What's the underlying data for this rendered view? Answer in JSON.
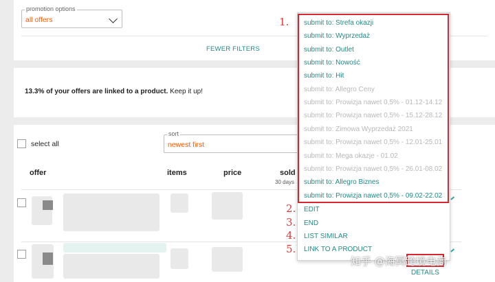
{
  "filters": {
    "promotion": {
      "legend": "promotion options",
      "value": "all offers"
    },
    "fewer_filters": "FEWER FILTERS"
  },
  "info": {
    "highlight": "13.3% of your offers are linked to a product.",
    "rest": " Keep it up!"
  },
  "list": {
    "select_all": "select all",
    "sort": {
      "legend": "sort",
      "value": "newest first"
    },
    "columns": {
      "offer": "offer",
      "items": "items",
      "price": "price",
      "sold": "sold",
      "sold_sub": "30 days"
    },
    "details": "DETAILS"
  },
  "dropdown": {
    "submit_items": [
      {
        "label": "submit to: Strefa okazji",
        "enabled": true
      },
      {
        "label": "submit to: Wyprzedaż",
        "enabled": true
      },
      {
        "label": "submit to: Outlet",
        "enabled": true
      },
      {
        "label": "submit to: Nowość",
        "enabled": true
      },
      {
        "label": "submit to: Hit",
        "enabled": true
      },
      {
        "label": "submit to: Allegro Ceny",
        "enabled": false
      },
      {
        "label": "submit to: Prowizja nawet 0,5% - 01.12-14.12",
        "enabled": false
      },
      {
        "label": "submit to: Prowizja nawet 0,5% - 15.12-28.12",
        "enabled": false
      },
      {
        "label": "submit to: Zimowa Wyprzedaż 2021",
        "enabled": false
      },
      {
        "label": "submit to: Prowizja nawet 0,5% - 12.01-25.01",
        "enabled": false
      },
      {
        "label": "submit to: Mega okazje - 01.02",
        "enabled": false
      },
      {
        "label": "submit to: Prowizja nawet 0,5% - 26.01-08.02",
        "enabled": false
      },
      {
        "label": "submit to: Allegro Biznes",
        "enabled": true
      },
      {
        "label": "submit to: Prowizja nawet 0,5% - 09.02-22.02",
        "enabled": true
      }
    ],
    "actions": {
      "edit": "EDIT",
      "end": "END",
      "list_similar": "LIST SIMILAR",
      "link_product": "LINK TO A PRODUCT"
    }
  },
  "annotations": {
    "n1": "1.",
    "n2": "2.",
    "n3": "3.",
    "n4": "4.",
    "n5": "5."
  },
  "watermark": "知乎 @海冥跨境电商",
  "colors": {
    "accent": "#1f8a86",
    "orange": "#ff5a00",
    "annotation_red": "#d8262e"
  }
}
